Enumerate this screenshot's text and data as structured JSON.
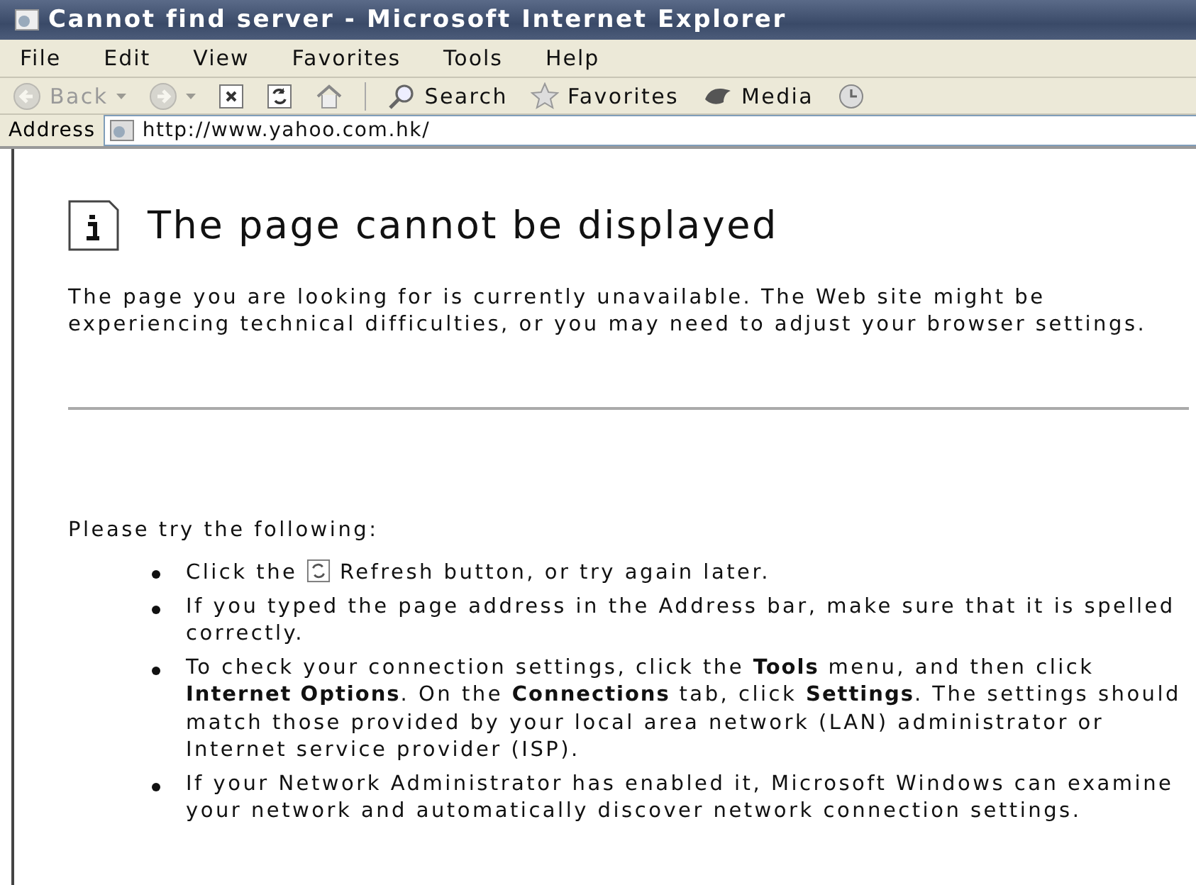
{
  "window": {
    "title": "Cannot find server - Microsoft Internet Explorer"
  },
  "menu": [
    "File",
    "Edit",
    "View",
    "Favorites",
    "Tools",
    "Help"
  ],
  "toolbar": [
    {
      "kind": "back",
      "label": "Back",
      "disabled": true
    },
    {
      "kind": "forward",
      "disabled": true
    },
    {
      "kind": "stop"
    },
    {
      "kind": "refresh"
    },
    {
      "kind": "home"
    },
    {
      "kind": "search",
      "label": "Search"
    },
    {
      "kind": "favorites",
      "label": "Favorites"
    },
    {
      "kind": "media",
      "label": "Media"
    },
    {
      "kind": "history"
    }
  ],
  "address": {
    "label": "Address",
    "value": "http://www.yahoo.com.hk/"
  },
  "page": {
    "heading": "The page cannot be displayed",
    "intro": "The page you are looking for is currently unavailable. The Web site might be experiencing technical difficulties, or you may need to adjust your browser settings.",
    "try_label": "Please try the following:",
    "bullets": [
      {
        "kind": "refresh",
        "before": "Click the",
        "after": "Refresh button, or try again later."
      },
      {
        "kind": "text",
        "text": "If you typed the page address in the Address bar, make sure that it is spelled correctly."
      },
      {
        "kind": "text",
        "text": "To check your connection settings, click the **Tools** menu, and then click **Internet Options**. On the **Connections** tab, click **Settings**. The settings should match those provided by your local area network (LAN) administrator or Internet service provider (ISP)."
      },
      {
        "kind": "text",
        "text": "If your Network Administrator has enabled it, Microsoft Windows can examine your network and automatically discover network connection settings."
      }
    ]
  }
}
